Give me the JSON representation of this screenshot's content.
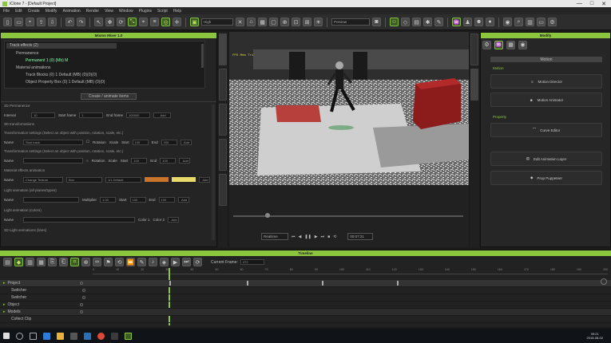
{
  "window": {
    "title": "iClone 7 - [Default Project]",
    "controls": [
      "—",
      "□",
      "✕"
    ]
  },
  "menu": [
    "File",
    "Edit",
    "Create",
    "Modify",
    "Animation",
    "Render",
    "View",
    "Window",
    "Plugins",
    "Script",
    "Help"
  ],
  "toolbar": {
    "render_mode": "High",
    "camera": "Preview"
  },
  "left_panel": {
    "title": "Mixmo Mixer 1.0",
    "tree": {
      "root": "Track effects (2)",
      "sub1": "Permanence",
      "sub1_item": "Permanent 1 (0) (Mb) M",
      "sub2": "Material animations",
      "sub2_item1": "Track Blocks (0) 1 Default (MB) (0)(0)(0)",
      "sub2_item2": "Object Property Box (0) 1 Default (MB) (0)(0)"
    },
    "create_button": "Create / animate items",
    "sections": {
      "s1": "3D Permanence",
      "s2": "3D transformations",
      "s3": "Transformation settings (Select an object with position, rotation, scale, etc.)",
      "s4": "Material effects animation",
      "s5": "Light animation (all planes/types)",
      "s6": "Light animation (colors)",
      "s7": "3D Light animations (lines)"
    },
    "rows": {
      "r1": {
        "label": "Interval",
        "v1": "10",
        "l2": "Start frame",
        "v2": "1",
        "l3": "End frame",
        "v3": "100000",
        "btn": "Add"
      },
      "r2": {
        "label": "Name",
        "v1": "Shot track",
        "l2": "Rotation",
        "l3": "Scale",
        "l4": "Start",
        "v4": "100",
        "l5": "End",
        "v5": "200",
        "btn": "Add"
      },
      "r3": {
        "label": "Name",
        "v1": "",
        "l2": "Rotation",
        "l3": "Scale",
        "l4": "Start",
        "v4": "100",
        "l5": "End",
        "v5": "100",
        "btn": "Add"
      },
      "r4": {
        "label": "Name",
        "v1": "Change Texture",
        "v2": "Box",
        "v3": "1/1 Default",
        "btn": "Add"
      },
      "r5": {
        "label": "Name",
        "l2": "Multiplier",
        "v2": "1.00",
        "l3": "Start",
        "v3": "100",
        "l4": "End",
        "v4": "100",
        "btn": "Add"
      },
      "r6": {
        "label": "Name",
        "l2": "Color 1",
        "l3": "Color 2",
        "btn": "Add"
      }
    },
    "swatch_colors": [
      "#c8742a",
      "#e7d96a"
    ]
  },
  "viewport": {
    "overlay_text": "FPS\nMem\nTri"
  },
  "playback": {
    "mode": "Realtime",
    "frame": "00:07:21",
    "buttons": [
      "⏮",
      "◀",
      "❚❚",
      "▶",
      "⏭",
      "■",
      "⟲"
    ]
  },
  "right_panel": {
    "title": "Modify",
    "subtitle": "Motion",
    "section_motion": "Motion",
    "section_property": "Property",
    "btn1": "Motion Director",
    "btn2": "Motion Animator",
    "btn3": "Curve Editor",
    "btn4": "Edit Animation Layer",
    "btn5": "Prop Puppeteer",
    "accent": "#8cc63f"
  },
  "timeline": {
    "title": "Timeline",
    "current_frame_label": "Current Frame:",
    "current_frame": "472",
    "tracks": [
      "Project",
      "Switcher",
      "Object",
      "Models",
      "Collect Clip"
    ],
    "ruler": [
      "0",
      "10",
      "20",
      "30",
      "40",
      "50",
      "60",
      "70",
      "80",
      "90",
      "100",
      "110",
      "120",
      "130",
      "140",
      "150",
      "160",
      "170",
      "180",
      "190",
      "200"
    ]
  },
  "taskbar": {
    "time": "09:21",
    "date": "2018-08-02",
    "apps": [
      "start",
      "search",
      "taskview",
      "edge",
      "explorer",
      "store",
      "mail",
      "chrome",
      "iclone",
      "app"
    ]
  }
}
